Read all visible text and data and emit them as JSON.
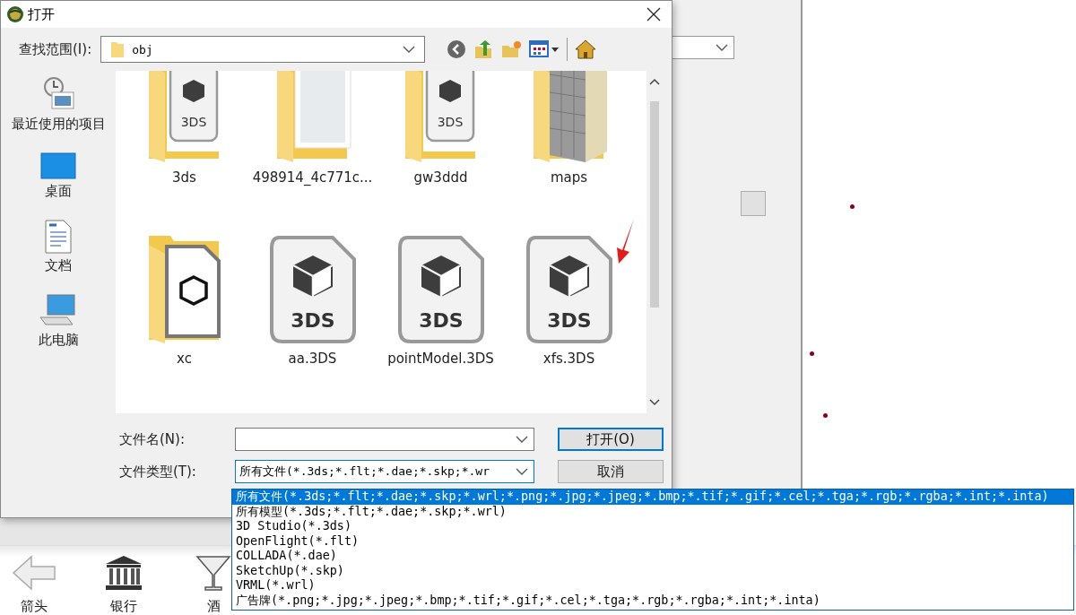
{
  "dialog": {
    "title": "打开",
    "look_in_label": "查找范围(I):",
    "look_in_value": "obj",
    "places": [
      {
        "kind": "recent",
        "label": "最近使用的项目"
      },
      {
        "kind": "desktop",
        "label": "桌面"
      },
      {
        "kind": "documents",
        "label": "文档"
      },
      {
        "kind": "computer",
        "label": "此电脑"
      }
    ],
    "files": [
      {
        "kind": "folder-file",
        "name": "3ds",
        "badge": "3DS"
      },
      {
        "kind": "folder-image",
        "name": "498914_4c771c..."
      },
      {
        "kind": "folder-file",
        "name": "gw3ddd",
        "badge": "3DS"
      },
      {
        "kind": "folder-texture",
        "name": "maps"
      },
      {
        "kind": "folder-model",
        "name": "xc"
      },
      {
        "kind": "file",
        "name": "aa.3DS",
        "badge": "3DS"
      },
      {
        "kind": "file",
        "name": "pointModel.3DS",
        "badge": "3DS"
      },
      {
        "kind": "file",
        "name": "xfs.3DS",
        "badge": "3DS"
      }
    ],
    "filename_label": "文件名(N):",
    "filetype_label": "文件类型(T):",
    "filetype_value": "所有文件(*.3ds;*.flt;*.dae;*.skp;*.wr",
    "buttons": [
      {
        "kind": "primary",
        "label": "打开(O)"
      },
      {
        "kind": "normal",
        "label": "取消"
      }
    ]
  },
  "filetype_list": [
    {
      "label": "所有文件(*.3ds;*.flt;*.dae;*.skp;*.wrl;*.png;*.jpg;*.jpeg;*.bmp;*.tif;*.gif;*.cel;*.tga;*.rgb;*.rgba;*.int;*.inta)",
      "selected": true
    },
    {
      "label": "所有模型(*.3ds;*.flt;*.dae;*.skp;*.wrl)",
      "selected": false
    },
    {
      "label": "3D Studio(*.3ds)",
      "selected": false
    },
    {
      "label": "OpenFlight(*.flt)",
      "selected": false
    },
    {
      "label": "COLLADA(*.dae)",
      "selected": false
    },
    {
      "label": "SketchUp(*.skp)",
      "selected": false
    },
    {
      "label": "VRML(*.wrl)",
      "selected": false
    },
    {
      "label": "广告牌(*.png;*.jpg;*.jpeg;*.bmp;*.tif;*.gif;*.cel;*.tga;*.rgb;*.rgba;*.int;*.inta)",
      "selected": false
    }
  ],
  "toolbar": [
    {
      "kind": "arrow",
      "label": "箭头"
    },
    {
      "kind": "bank",
      "label": "银行"
    },
    {
      "kind": "bar",
      "label": "酒"
    }
  ]
}
